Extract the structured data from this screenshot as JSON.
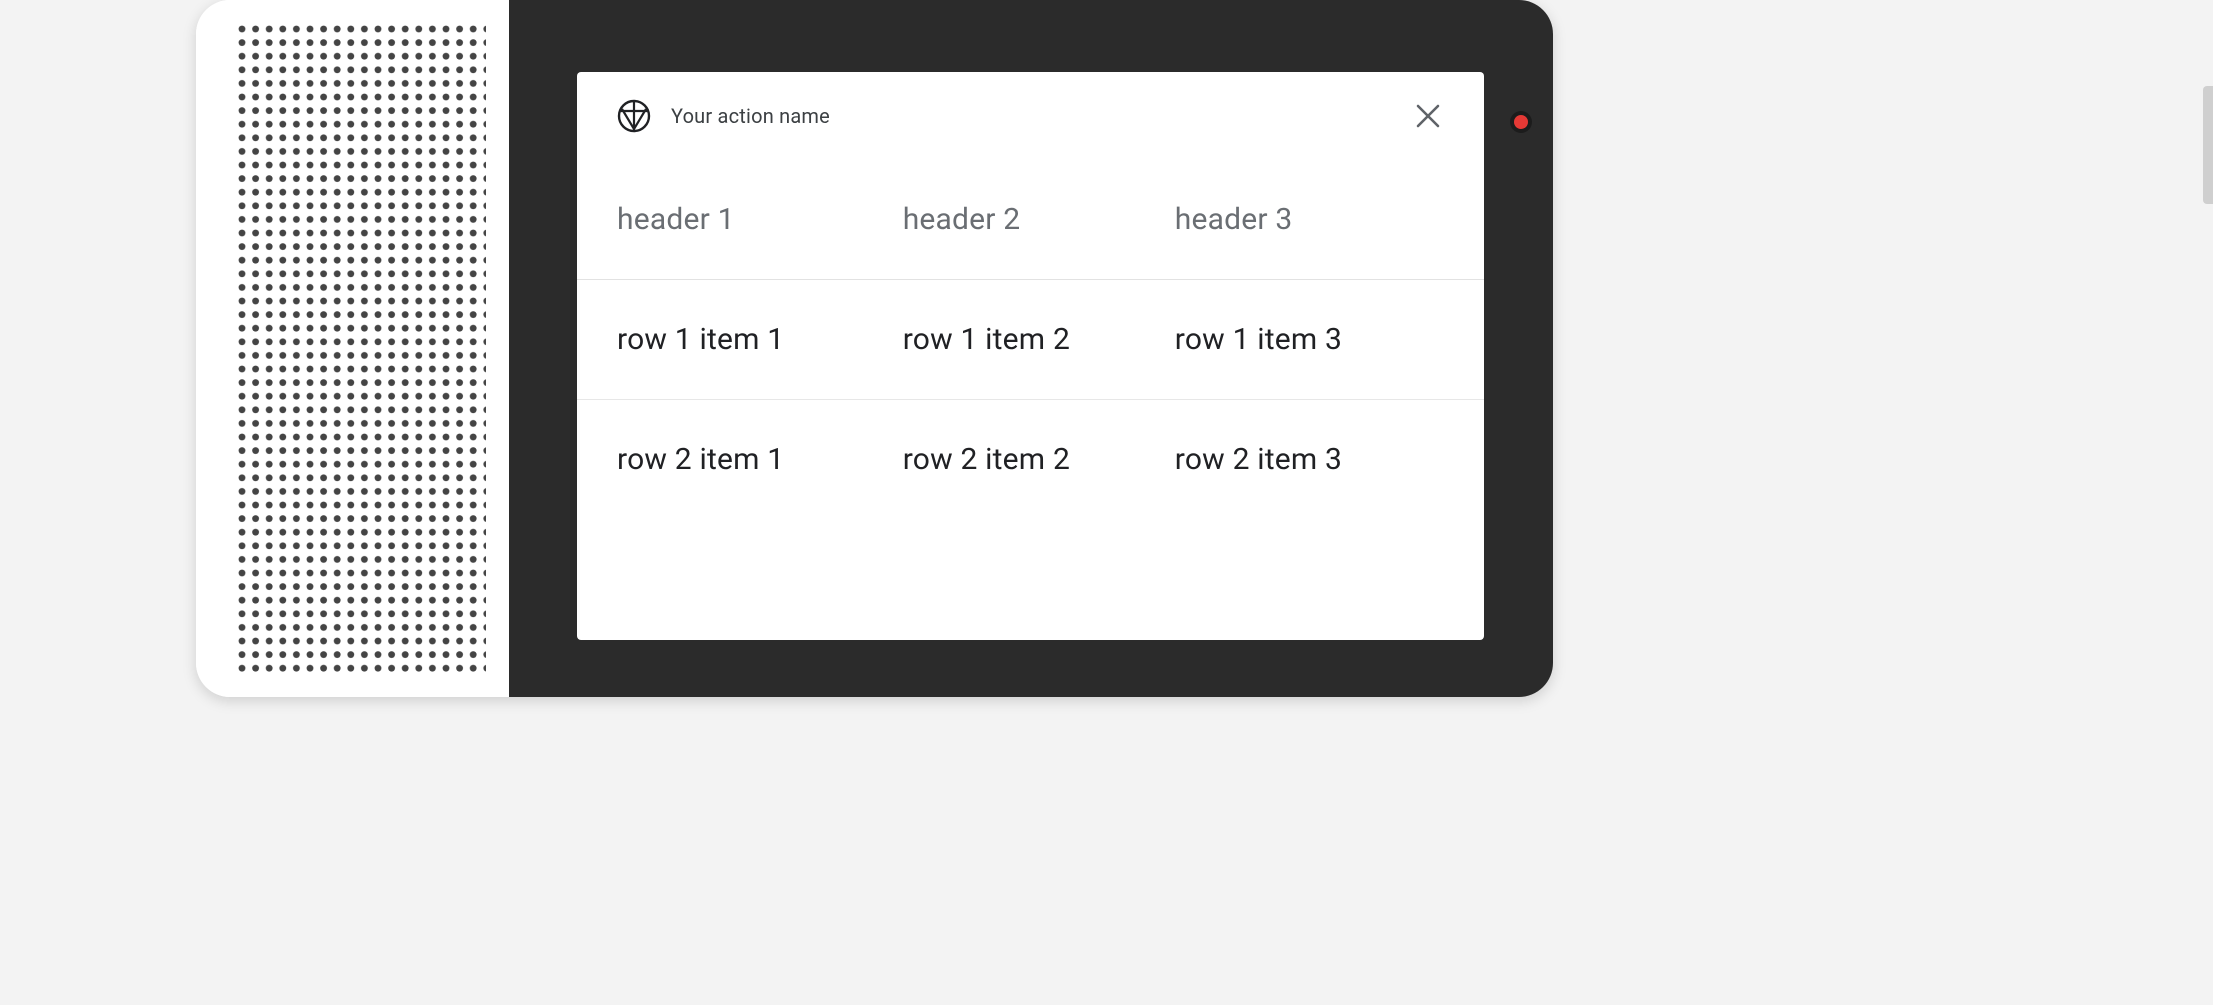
{
  "card": {
    "title": "Your action name",
    "table": {
      "headers": [
        "header 1",
        "header 2",
        "header 3"
      ],
      "rows": [
        [
          "row 1 item 1",
          "row 1 item 2",
          "row 1 item 3"
        ],
        [
          "row 2 item 1",
          "row 2 item 2",
          "row 2 item 3"
        ]
      ]
    }
  }
}
